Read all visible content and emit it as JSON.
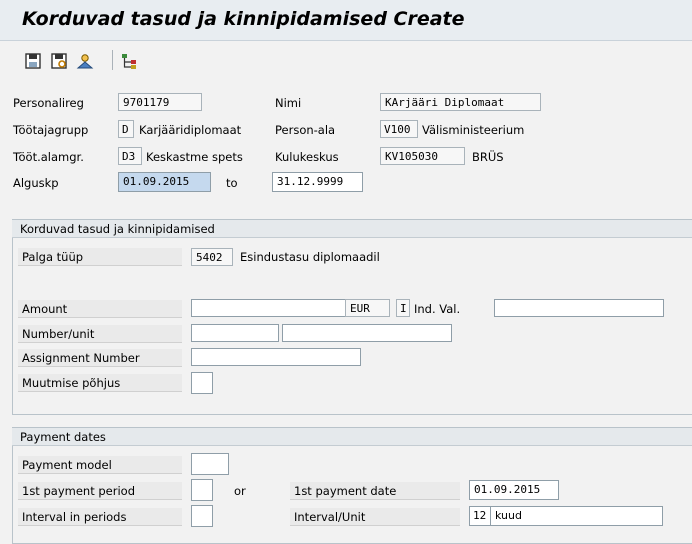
{
  "window": {
    "title": "Korduvad tasud ja kinnipidamised Create"
  },
  "toolbar": {
    "icons": [
      "save-icon",
      "overview-icon",
      "person-icon",
      "tree-icon"
    ]
  },
  "header": {
    "personalireg": {
      "label": "Personalireg",
      "value": "9701179"
    },
    "nimi": {
      "label": "Nimi",
      "value": "KArjääri Diplomaat"
    },
    "tootajagrupp": {
      "label": "Töötajagrupp",
      "code": "D",
      "text": "Karjääridiplomaat"
    },
    "person_ala": {
      "label": "Person-ala",
      "code": "V100",
      "text": "Välisministeerium"
    },
    "toot_alamgr": {
      "label": "Tööt.alamgr.",
      "code": "D3",
      "text": "Keskastme spets"
    },
    "kulukeskus": {
      "label": "Kulukeskus",
      "code": "KV105030",
      "text": "BRÜS"
    },
    "alguskp": {
      "label": "Alguskp",
      "from": "01.09.2015",
      "to_label": "to",
      "to": "31.12.9999"
    }
  },
  "group1": {
    "title": "Korduvad tasud ja kinnipidamised",
    "palga_tuup": {
      "label": "Palga tüüp",
      "code": "5402",
      "text": "Esindustasu diplomaadil"
    },
    "amount": {
      "label": "Amount",
      "value": "",
      "currency": "EUR",
      "ind_flag": "I",
      "ind_label": "Ind. Val.",
      "ind_value": ""
    },
    "number_unit": {
      "label": "Number/unit",
      "number": "",
      "unit": ""
    },
    "assignment_number": {
      "label": "Assignment Number",
      "value": ""
    },
    "muutmise_pohjus": {
      "label": "Muutmise põhjus",
      "value": ""
    }
  },
  "group2": {
    "title": "Payment dates",
    "payment_model": {
      "label": "Payment model",
      "value": ""
    },
    "first_period": {
      "label": "1st payment period",
      "value": "",
      "or_label": "or"
    },
    "first_date": {
      "label": "1st payment date",
      "value": "01.09.2015"
    },
    "interval_periods": {
      "label": "Interval in periods",
      "value": ""
    },
    "interval_unit": {
      "label": "Interval/Unit",
      "number": "12",
      "unit": "kuud"
    }
  },
  "colors": {
    "highlight": "#c5d9ee",
    "field_border": "#8f9ea8",
    "background": "#f2f2f2"
  }
}
